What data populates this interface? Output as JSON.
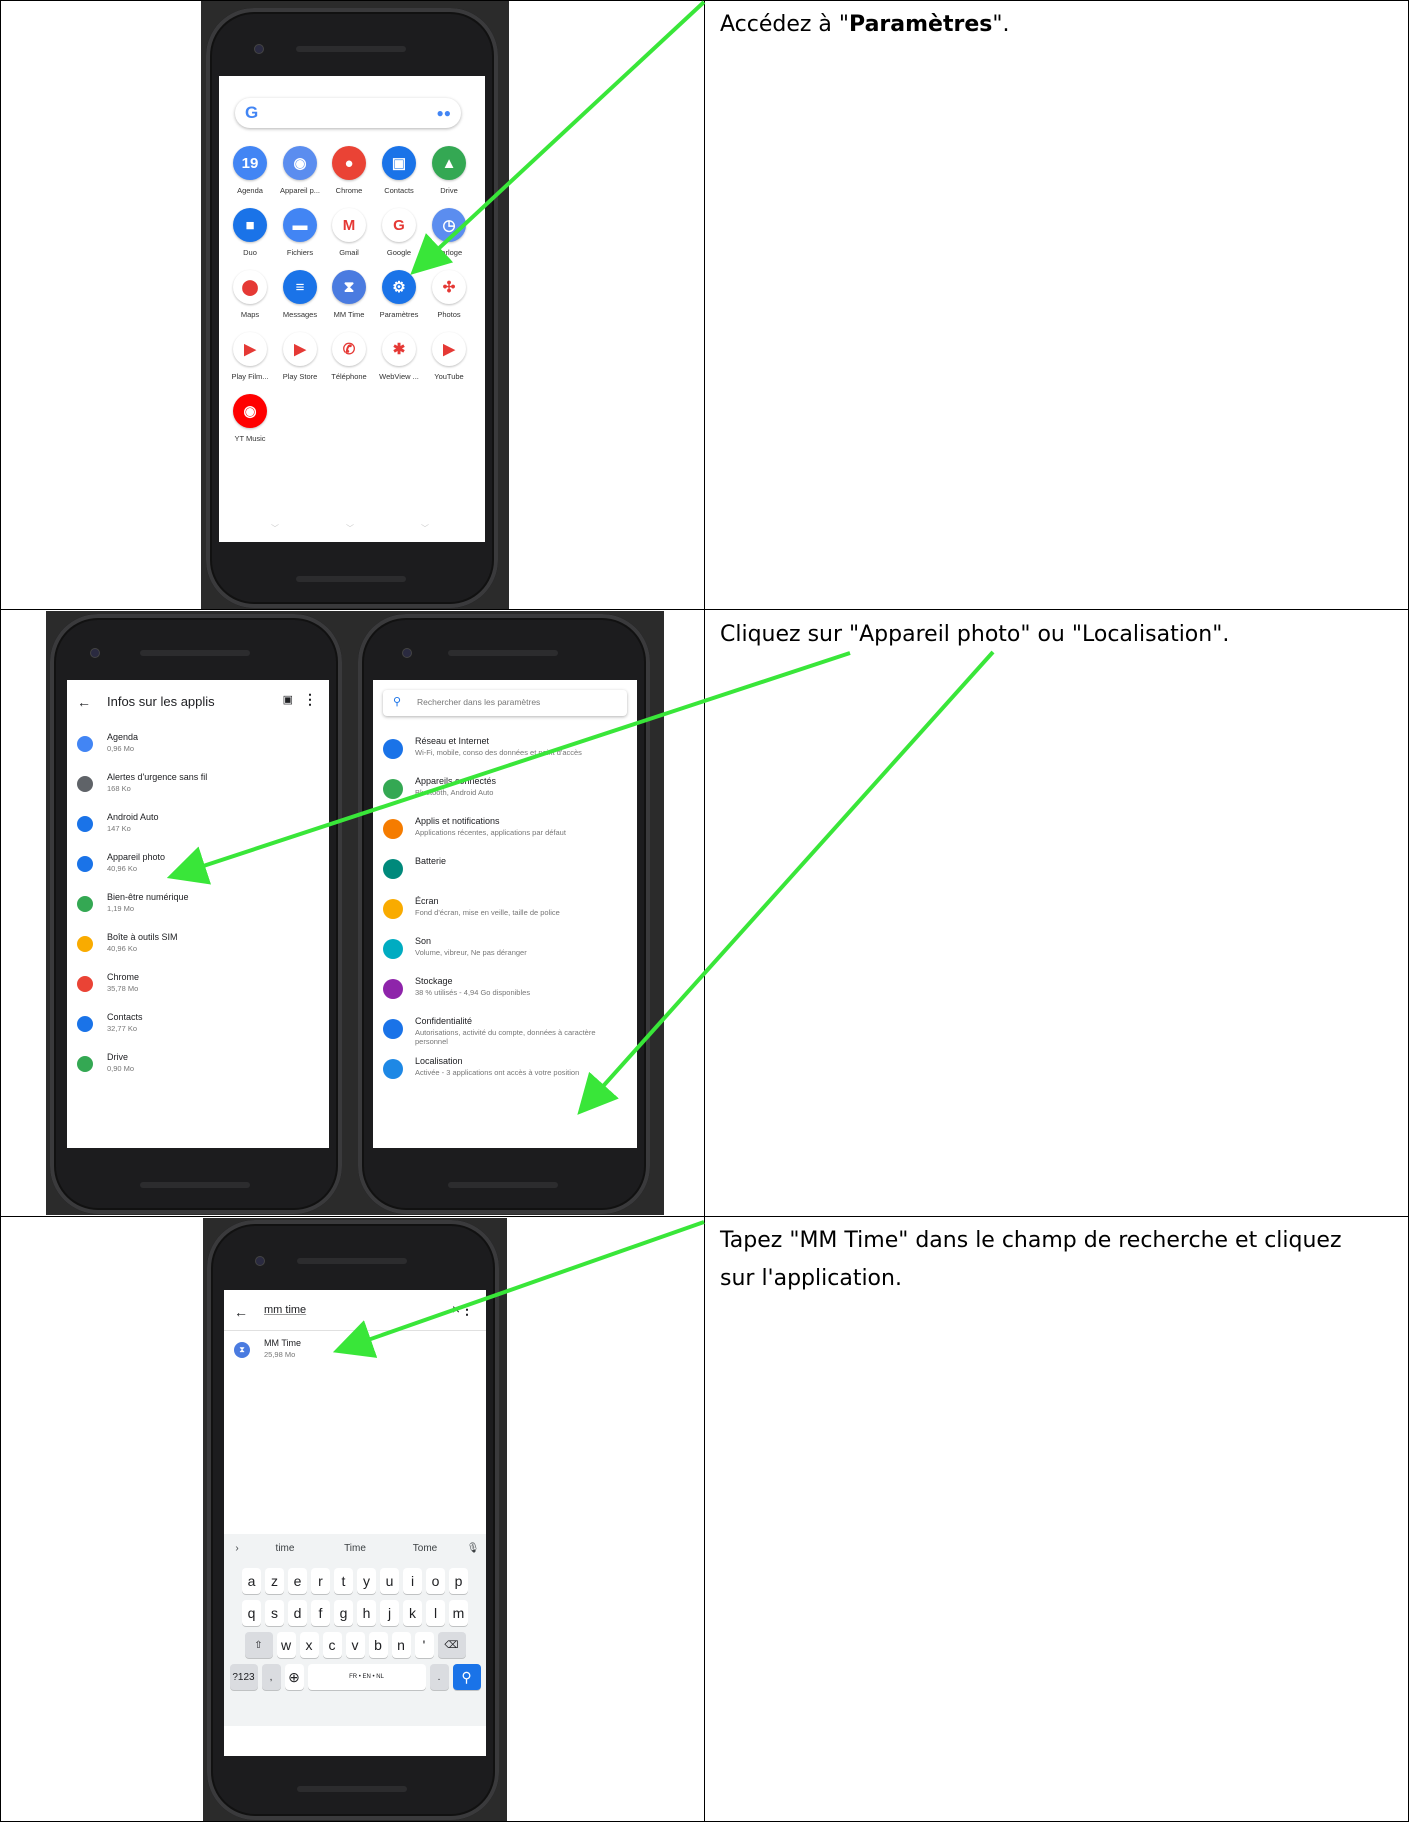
{
  "instructions": {
    "step1_prefix": "Accédez à \"",
    "step1_bold": "Paramètres",
    "step1_suffix": "\".",
    "step2": "Cliquez sur \"Appareil photo\" ou \"Localisation\".",
    "step3": "Tapez \"MM Time\" dans le champ de recherche et cliquez sur l'application."
  },
  "launcher": {
    "apps": [
      {
        "label": "Agenda",
        "glyph": "19",
        "color": "#4285f4",
        "icon": "calendar-icon"
      },
      {
        "label": "Appareil p...",
        "glyph": "◉",
        "color": "#5b8def",
        "icon": "camera-icon"
      },
      {
        "label": "Chrome",
        "glyph": "●",
        "color": "#ea4335",
        "icon": "chrome-icon"
      },
      {
        "label": "Contacts",
        "glyph": "▣",
        "color": "#1a73e8",
        "icon": "contacts-icon"
      },
      {
        "label": "Drive",
        "glyph": "▲",
        "color": "#34a853",
        "icon": "drive-icon"
      },
      {
        "label": "Duo",
        "glyph": "■",
        "color": "#1a73e8",
        "icon": "duo-icon"
      },
      {
        "label": "Fichiers",
        "glyph": "▬",
        "color": "#4285f4",
        "icon": "files-icon"
      },
      {
        "label": "Gmail",
        "glyph": "M",
        "color": "#ffffff",
        "icon": "gmail-icon"
      },
      {
        "label": "Google",
        "glyph": "G",
        "color": "#ffffff",
        "icon": "google-icon"
      },
      {
        "label": "Horloge",
        "glyph": "◷",
        "color": "#5b8def",
        "icon": "clock-icon"
      },
      {
        "label": "Maps",
        "glyph": "⬤",
        "color": "#ffffff",
        "icon": "maps-icon"
      },
      {
        "label": "Messages",
        "glyph": "≡",
        "color": "#1a73e8",
        "icon": "messages-icon"
      },
      {
        "label": "MM Time",
        "glyph": "⧗",
        "color": "#4a7be0",
        "icon": "hourglass-icon"
      },
      {
        "label": "Paramètres",
        "glyph": "⚙",
        "color": "#1a73e8",
        "icon": "settings-gear-icon"
      },
      {
        "label": "Photos",
        "glyph": "✣",
        "color": "#ffffff",
        "icon": "photos-icon"
      },
      {
        "label": "Play Film...",
        "glyph": "▶",
        "color": "#ffffff",
        "icon": "play-movies-icon"
      },
      {
        "label": "Play Store",
        "glyph": "▶",
        "color": "#ffffff",
        "icon": "play-store-icon"
      },
      {
        "label": "Téléphone",
        "glyph": "✆",
        "color": "#ffffff",
        "icon": "phone-icon"
      },
      {
        "label": "WebView ...",
        "glyph": "✱",
        "color": "#ffffff",
        "icon": "webview-icon"
      },
      {
        "label": "YouTube",
        "glyph": "▶",
        "color": "#ffffff",
        "icon": "youtube-icon"
      },
      {
        "label": "YT Music",
        "glyph": "◉",
        "color": "#ff0000",
        "icon": "yt-music-icon"
      }
    ]
  },
  "appinfo": {
    "title": "Infos sur les applis",
    "items": [
      {
        "name": "Agenda",
        "size": "0,96 Mo",
        "color": "#4285f4",
        "icon": "calendar-icon"
      },
      {
        "name": "Alertes d'urgence sans fil",
        "size": "168 Ko",
        "color": "#5f6368",
        "icon": "alert-icon"
      },
      {
        "name": "Android Auto",
        "size": "147 Ko",
        "color": "#1a73e8",
        "icon": "android-auto-icon"
      },
      {
        "name": "Appareil photo",
        "size": "40,96 Ko",
        "color": "#1a73e8",
        "icon": "camera-icon"
      },
      {
        "name": "Bien-être numérique",
        "size": "1,19 Mo",
        "color": "#34a853",
        "icon": "wellbeing-icon"
      },
      {
        "name": "Boîte à outils SIM",
        "size": "40,96 Ko",
        "color": "#f9ab00",
        "icon": "sim-icon"
      },
      {
        "name": "Chrome",
        "size": "35,78 Mo",
        "color": "#ea4335",
        "icon": "chrome-icon"
      },
      {
        "name": "Contacts",
        "size": "32,77 Ko",
        "color": "#1a73e8",
        "icon": "contacts-icon"
      },
      {
        "name": "Drive",
        "size": "0,90 Mo",
        "color": "#34a853",
        "icon": "drive-icon"
      }
    ]
  },
  "settings": {
    "search_placeholder": "Rechercher dans les paramètres",
    "items": [
      {
        "name": "Réseau et Internet",
        "sub": "Wi-Fi, mobile, conso des données et point d'accès",
        "color": "#1a73e8",
        "icon": "wifi-icon"
      },
      {
        "name": "Appareils connectés",
        "sub": "Bluetooth, Android Auto",
        "color": "#34a853",
        "icon": "devices-icon"
      },
      {
        "name": "Applis et notifications",
        "sub": "Applications récentes, applications par défaut",
        "color": "#f57c00",
        "icon": "apps-grid-icon"
      },
      {
        "name": "Batterie",
        "sub": "",
        "color": "#00897b",
        "icon": "battery-icon"
      },
      {
        "name": "Écran",
        "sub": "Fond d'écran, mise en veille, taille de police",
        "color": "#f9ab00",
        "icon": "display-icon"
      },
      {
        "name": "Son",
        "sub": "Volume, vibreur, Ne pas déranger",
        "color": "#00acc1",
        "icon": "sound-icon"
      },
      {
        "name": "Stockage",
        "sub": "38 % utilisés - 4,94 Go disponibles",
        "color": "#8e24aa",
        "icon": "storage-icon"
      },
      {
        "name": "Confidentialité",
        "sub": "Autorisations, activité du compte, données à caractère personnel",
        "color": "#1a73e8",
        "icon": "privacy-icon"
      },
      {
        "name": "Localisation",
        "sub": "Activée - 3 applications ont accès à votre position",
        "color": "#1e88e5",
        "icon": "location-icon"
      }
    ]
  },
  "search_screen": {
    "query": "mm time",
    "result_name": "MM Time",
    "result_size": "25,98 Mo",
    "clear": "×"
  },
  "keyboard": {
    "suggestions": [
      "time",
      "Time",
      "Tome"
    ],
    "row1": [
      "a",
      "z",
      "e",
      "r",
      "t",
      "y",
      "u",
      "i",
      "o",
      "p"
    ],
    "row2": [
      "q",
      "s",
      "d",
      "f",
      "g",
      "h",
      "j",
      "k",
      "l",
      "m"
    ],
    "row3": [
      "w",
      "x",
      "c",
      "v",
      "b",
      "n",
      "'"
    ],
    "num_key": "?123",
    "comma": ",",
    "space": "FR • EN • NL",
    "period": "."
  }
}
